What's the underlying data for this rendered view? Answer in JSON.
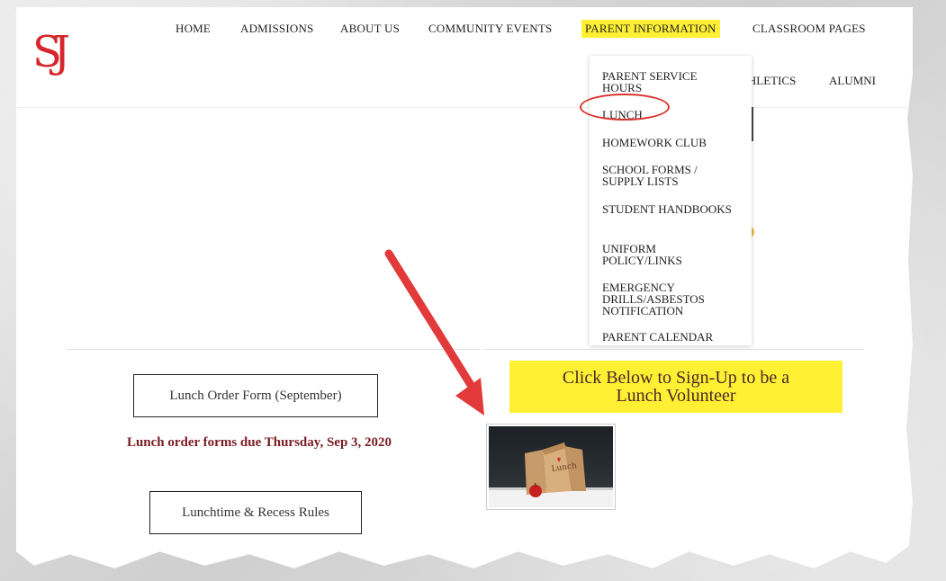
{
  "nav": {
    "primary": [
      {
        "label": "HOME"
      },
      {
        "label": "ADMISSIONS"
      },
      {
        "label": "ABOUT US"
      },
      {
        "label": "COMMUNITY EVENTS"
      },
      {
        "label": "PARENT INFORMATION"
      },
      {
        "label": "CLASSROOM PAGES"
      }
    ],
    "secondary": [
      {
        "label": "ATHLETICS"
      },
      {
        "label": "ALUMNI"
      }
    ]
  },
  "logo": {
    "letters": "SJ"
  },
  "dropdown": {
    "items": [
      {
        "label": "PARENT SERVICE HOURS"
      },
      {
        "label": "LUNCH"
      },
      {
        "label": "HOMEWORK CLUB"
      },
      {
        "label": "SCHOOL FORMS / SUPPLY LISTS"
      },
      {
        "label": "STUDENT HANDBOOKS"
      },
      {
        "label": "UNIFORM POLICY/LINKS"
      },
      {
        "label": "EMERGENCY DRILLS/ASBESTOS NOTIFICATION"
      },
      {
        "label": "PARENT CALENDAR"
      }
    ]
  },
  "content": {
    "lunch_order_button": "Lunch Order Form (September)",
    "due_text": "Lunch order forms due Thursday, Sep 3, 2020",
    "recess_button": "Lunchtime & Recess Rules",
    "volunteer_line1": "Click Below to Sign-Up to be a",
    "volunteer_line2": "Lunch Volunteer"
  },
  "colors": {
    "highlight": "#fff033",
    "logo": "#d6262c",
    "annotation_red": "#e23a3a",
    "due_text": "#7a1d23"
  }
}
